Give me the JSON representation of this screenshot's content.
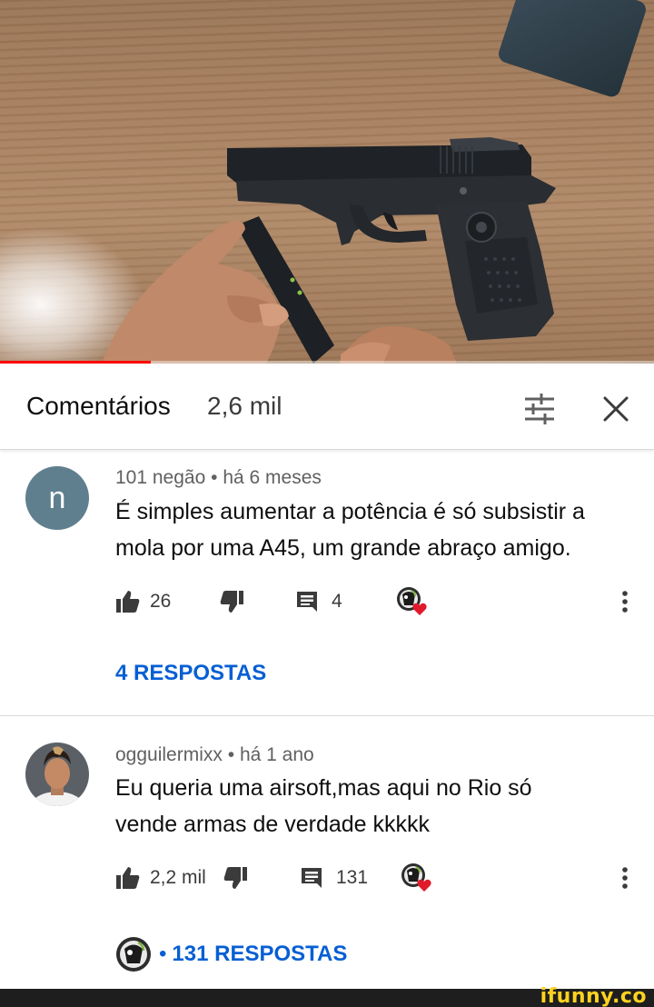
{
  "video": {
    "progress_fraction": 0.23
  },
  "comments_header": {
    "title": "Comentários",
    "count": "2,6 mil"
  },
  "comments": [
    {
      "avatar_letter": "n",
      "author": "101 negão",
      "time": "há 6 meses",
      "text": "É simples aumentar a potência é só subsistir a mola por uma A45, um grande abraço amigo.",
      "likes": "26",
      "reply_count": "4",
      "replies_link": "4 RESPOSTAS"
    },
    {
      "author": "ogguilermixx",
      "time": "há 1 ano",
      "text": "Eu queria uma airsoft,mas aqui no Rio só vende armas de verdade kkkkk",
      "likes": "2,2 mil",
      "reply_count": "131",
      "replies_link": "131 RESPOSTAS"
    }
  ],
  "separator": "•",
  "watermark": "ifunny.co",
  "colors": {
    "link_blue": "#065fd4",
    "progress_red": "#ff0000",
    "heart_red": "#e0192b",
    "avatar_n_bg": "#5f7f8f"
  }
}
